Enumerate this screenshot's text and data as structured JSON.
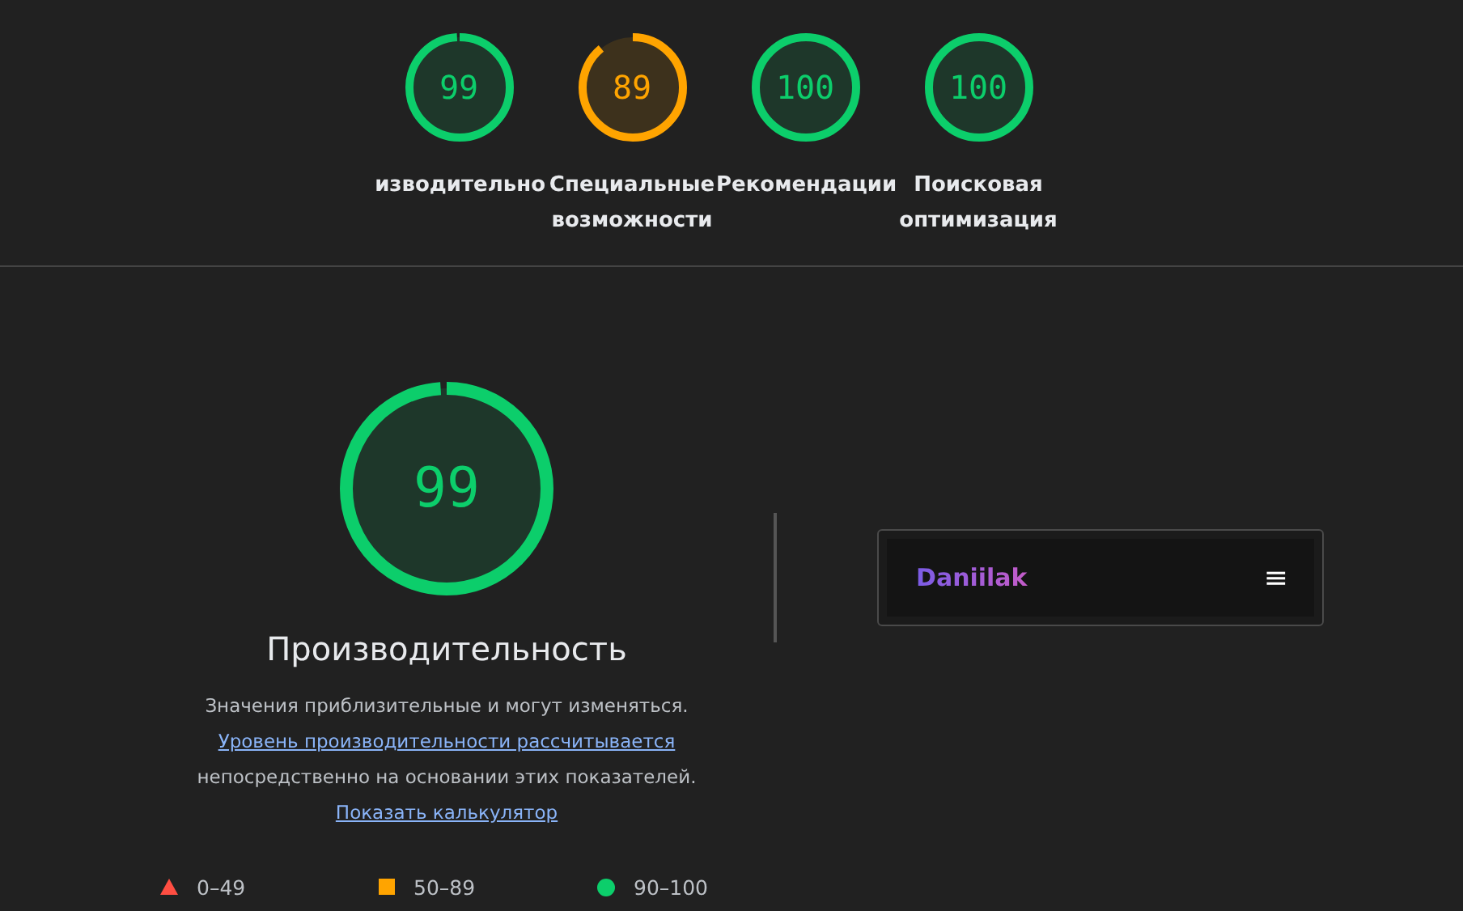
{
  "categories": [
    {
      "score": "99",
      "color": "#0cce6b",
      "label": "изводительно"
    },
    {
      "score": "89",
      "color": "#ffa400",
      "label": "Специальные возможности"
    },
    {
      "score": "100",
      "color": "#0cce6b",
      "label": "Рекомендации"
    },
    {
      "score": "100",
      "color": "#0cce6b",
      "label": "Поисковая оптимизация"
    }
  ],
  "performance": {
    "score": "99",
    "color": "#0cce6b",
    "title": "Производительность",
    "description": [
      {
        "kind": "text",
        "text": "Значения приблизительные и могут изменяться. "
      },
      {
        "kind": "link",
        "text": "Уровень производительности рассчитывается"
      },
      {
        "kind": "text",
        "text": " непосредственно на основании этих показателей. "
      },
      {
        "kind": "link",
        "text": "Показать калькулятор"
      }
    ],
    "legend": [
      {
        "kind": "triangle",
        "color": "#ff4e42",
        "text": "0–49"
      },
      {
        "kind": "square",
        "color": "#ffa400",
        "text": "50–89"
      },
      {
        "kind": "circle",
        "color": "#0cce6b",
        "text": "90–100"
      }
    ]
  },
  "screenshot": {
    "logo": "Daniilak",
    "menu": "≡"
  }
}
